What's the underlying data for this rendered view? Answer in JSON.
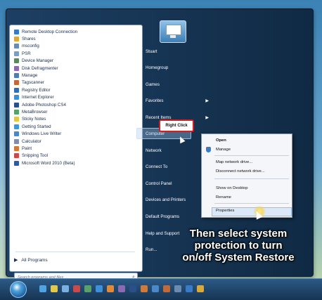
{
  "start_menu": {
    "programs": [
      {
        "label": "Remote Desktop Connection",
        "color": "#3a7bc8"
      },
      {
        "label": "Shares",
        "color": "#d9a93a"
      },
      {
        "label": "msconfig",
        "color": "#6b8cb0"
      },
      {
        "label": "PSR",
        "color": "#7a9ec4"
      },
      {
        "label": "Device Manager",
        "color": "#5a8a5a"
      },
      {
        "label": "Disk Defragmenter",
        "color": "#8a6ab0"
      },
      {
        "label": "Manage",
        "color": "#4f7db0"
      },
      {
        "label": "Tagscanner",
        "color": "#c06a3a"
      },
      {
        "label": "Registry Editor",
        "color": "#2f6fb8"
      },
      {
        "label": "Internet Explorer",
        "color": "#3c8fd8"
      },
      {
        "label": "Adobe Photoshop CS4",
        "color": "#2a4f8a"
      },
      {
        "label": "MetaBrowser",
        "color": "#5aa06a"
      },
      {
        "label": "Sticky Notes",
        "color": "#e0c84a"
      },
      {
        "label": "Getting Started",
        "color": "#3a9ad8"
      },
      {
        "label": "Windows Live Writer",
        "color": "#4b88c8"
      },
      {
        "label": "Calculator",
        "color": "#8090a8"
      },
      {
        "label": "Paint",
        "color": "#d07a3a"
      },
      {
        "label": "Snipping Tool",
        "color": "#c84a4a"
      },
      {
        "label": "Microsoft Word 2010 (Beta)",
        "color": "#2c5aa8"
      }
    ],
    "all_programs": "All Programs",
    "search_placeholder": "Search programs and files",
    "right_items": [
      {
        "label": "Stuart",
        "has_arrow": false
      },
      {
        "label": "Homegroup",
        "has_arrow": false
      },
      {
        "label": "Games",
        "has_arrow": false
      },
      {
        "label": "Favorites",
        "has_arrow": true
      },
      {
        "label": "Recent Items",
        "has_arrow": true
      },
      {
        "label": "Computer",
        "has_arrow": false
      },
      {
        "label": "Network",
        "has_arrow": false
      },
      {
        "label": "Connect To",
        "has_arrow": false
      },
      {
        "label": "Control Panel",
        "has_arrow": false
      },
      {
        "label": "Devices and Printers",
        "has_arrow": false
      },
      {
        "label": "Default Programs",
        "has_arrow": false
      },
      {
        "label": "Help and Support",
        "has_arrow": false
      },
      {
        "label": "Run...",
        "has_arrow": false
      }
    ]
  },
  "callout": {
    "label": "Right Click"
  },
  "context_menu": {
    "items": [
      {
        "label": "Open",
        "bold": true
      },
      {
        "label": "Manage",
        "bold": false
      },
      {
        "label": "Map network drive...",
        "bold": false
      },
      {
        "label": "Disconnect network drive...",
        "bold": false
      },
      {
        "label": "Show on Desktop",
        "bold": false
      },
      {
        "label": "Rename",
        "bold": false
      },
      {
        "label": "Properties",
        "bold": false
      }
    ]
  },
  "caption": {
    "lines": [
      "Then select system",
      "protection to turn",
      "on/off System Restore"
    ]
  },
  "taskbar": {
    "icon_colors": [
      "#4fa3e0",
      "#e0c84a",
      "#7ab0e0",
      "#c84a4a",
      "#5aa06a",
      "#3c8fd8",
      "#e08a3a",
      "#8a6ab0",
      "#2a4f8a",
      "#d07a3a",
      "#4b88c8",
      "#c06a3a",
      "#6b8cb0",
      "#3a7bc8",
      "#d9a93a"
    ]
  }
}
